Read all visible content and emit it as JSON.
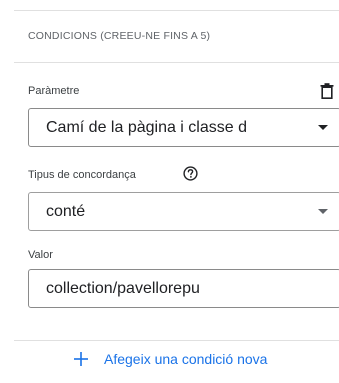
{
  "section": {
    "title": "CONDICIONS (CREEU-NE FINS A 5)"
  },
  "parameter": {
    "label": "Paràmetre",
    "value": "Camí de la pàgina i classe d",
    "delete_icon": "trash-icon"
  },
  "match_type": {
    "label": "Tipus de concordança",
    "help_icon": "help-circle-icon",
    "value": "conté"
  },
  "value_field": {
    "label": "Valor",
    "value": "collection/pavellorepu"
  },
  "add_condition": {
    "label": "Afegeix una condició nova",
    "icon": "plus-icon"
  },
  "colors": {
    "accent": "#1a73e8",
    "text": "#202124",
    "muted": "#5f6368",
    "border": "#8a8a8a",
    "divider": "#e0e0e0"
  }
}
